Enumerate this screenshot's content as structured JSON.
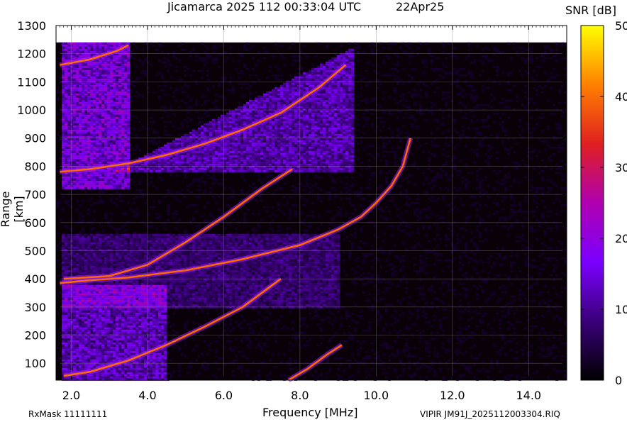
{
  "header": {
    "title": "Jicamarca 2025 112 00:33:04 UTC",
    "date": "22Apr25"
  },
  "footer": {
    "rxmask": "RxMask 11111111",
    "filename": "VIPIR  JM91J_2025112003304.RIQ"
  },
  "chart_data": {
    "type": "heatmap",
    "title": "Jicamarca 2025 112 00:33:04 UTC",
    "xlabel": "Frequency [MHz]",
    "ylabel": "Range [km]",
    "xlim": [
      1.6,
      15.0
    ],
    "ylim": [
      40,
      1300
    ],
    "data_ylim": [
      40,
      1240
    ],
    "x_ticks": [
      "2.0",
      "4.0",
      "6.0",
      "8.0",
      "10.0",
      "12.0",
      "14.0"
    ],
    "y_ticks": [
      "100",
      "200",
      "300",
      "400",
      "500",
      "600",
      "700",
      "800",
      "900",
      "1000",
      "1100",
      "1200",
      "1300"
    ],
    "grid": true,
    "colorbar": {
      "label": "SNR [dB]",
      "range": [
        0,
        50
      ],
      "ticks": [
        "0",
        "10",
        "20",
        "30",
        "40",
        "50"
      ],
      "colormap": [
        "#000000",
        "#3a007a",
        "#7b00ff",
        "#b000b0",
        "#e02020",
        "#ff8000",
        "#ffff00"
      ]
    },
    "traces": [
      {
        "name": "",
        "points": [
          [
            1.8,
            55
          ],
          [
            2.5,
            70
          ],
          [
            3.5,
            110
          ],
          [
            4.5,
            165
          ],
          [
            5.5,
            230
          ],
          [
            6.5,
            300
          ],
          [
            7.2,
            370
          ],
          [
            7.5,
            400
          ]
        ]
      },
      {
        "name": "",
        "points": [
          [
            1.7,
            385
          ],
          [
            2.5,
            395
          ],
          [
            3.5,
            405
          ],
          [
            5.0,
            430
          ],
          [
            6.5,
            470
          ],
          [
            8.0,
            520
          ],
          [
            9.0,
            575
          ],
          [
            9.6,
            620
          ],
          [
            10.0,
            670
          ],
          [
            10.4,
            730
          ],
          [
            10.7,
            800
          ],
          [
            10.9,
            900
          ]
        ]
      },
      {
        "name": "",
        "points": [
          [
            1.8,
            400
          ],
          [
            3.0,
            410
          ],
          [
            4.0,
            450
          ],
          [
            5.0,
            530
          ],
          [
            6.0,
            620
          ],
          [
            7.0,
            720
          ],
          [
            7.8,
            790
          ]
        ]
      },
      {
        "name": "",
        "points": [
          [
            1.7,
            780
          ],
          [
            2.5,
            790
          ],
          [
            3.5,
            810
          ],
          [
            4.5,
            840
          ],
          [
            5.5,
            880
          ],
          [
            6.5,
            930
          ],
          [
            7.5,
            990
          ],
          [
            8.5,
            1080
          ],
          [
            9.2,
            1160
          ]
        ]
      },
      {
        "name": "",
        "points": [
          [
            1.7,
            1160
          ],
          [
            2.5,
            1180
          ],
          [
            3.2,
            1210
          ],
          [
            3.5,
            1230
          ]
        ]
      },
      {
        "name": "",
        "points": [
          [
            7.7,
            40
          ],
          [
            8.2,
            80
          ],
          [
            8.7,
            130
          ],
          [
            9.1,
            165
          ]
        ]
      }
    ]
  }
}
